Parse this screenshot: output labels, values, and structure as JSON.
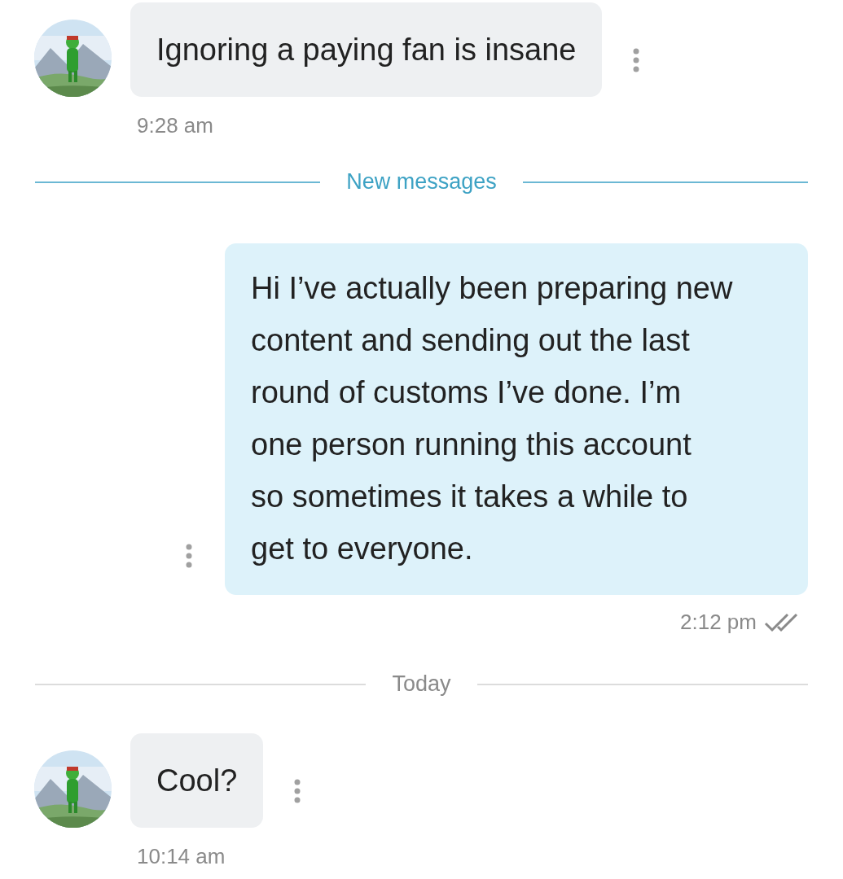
{
  "messages": [
    {
      "kind": "incoming",
      "text": "Ignoring a paying fan is insane",
      "time": "9:28 am"
    },
    {
      "kind": "divider",
      "label": "New messages",
      "unread": true
    },
    {
      "kind": "outgoing",
      "text": "Hi I’ve actually been preparing new\ncontent and sending out the last\nround of customs I’ve done. I’m\none person running this account\nso sometimes it takes a while to\nget to everyone.",
      "time": "2:12 pm",
      "read": true
    },
    {
      "kind": "divider",
      "label": "Today",
      "unread": false
    },
    {
      "kind": "incoming",
      "text": "Cool?",
      "time": "10:14 am"
    }
  ]
}
